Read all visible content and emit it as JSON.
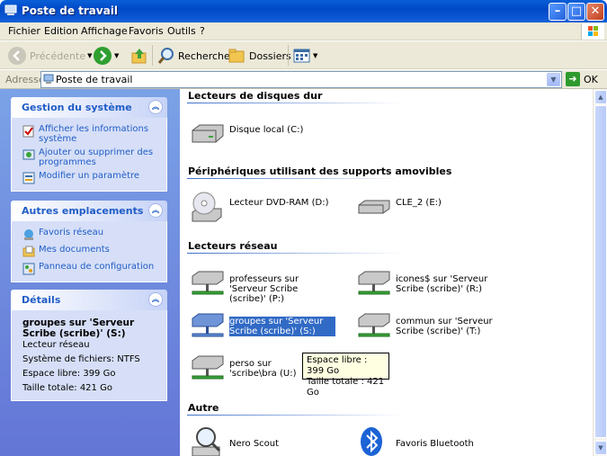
{
  "window": {
    "title": "Poste de travail"
  },
  "menu": [
    "Fichier",
    "Edition",
    "Affichage",
    "Favoris",
    "Outils",
    "?"
  ],
  "toolbar": {
    "back": "Précédente",
    "search": "Rechercher",
    "folders": "Dossiers"
  },
  "address": {
    "label": "Adresse",
    "value": "Poste de travail",
    "go": "OK"
  },
  "sidebar": {
    "system": {
      "title": "Gestion du système",
      "items": [
        {
          "label": "Afficher les informations système",
          "icon": "system-info-icon"
        },
        {
          "label": "Ajouter ou supprimer des programmes",
          "icon": "add-remove-icon"
        },
        {
          "label": "Modifier un paramètre",
          "icon": "settings-icon"
        }
      ]
    },
    "places": {
      "title": "Autres emplacements",
      "items": [
        {
          "label": "Favoris réseau",
          "icon": "network-icon"
        },
        {
          "label": "Mes documents",
          "icon": "folder-icon"
        },
        {
          "label": "Panneau de configuration",
          "icon": "control-panel-icon"
        }
      ]
    },
    "details": {
      "title": "Détails",
      "name": "groupes sur 'Serveur Scribe (scribe)' (S:)",
      "type": "Lecteur réseau",
      "fs": "Système de fichiers: NTFS",
      "free": "Espace libre: 399 Go",
      "total": "Taille totale: 421 Go"
    }
  },
  "groups": {
    "hdd": {
      "title": "Lecteurs de disques dur",
      "items": [
        "Disque local (C:)"
      ]
    },
    "removable": {
      "title": "Périphériques utilisant des supports amovibles",
      "items": [
        "Lecteur DVD-RAM (D:)",
        "CLE_2 (E:)"
      ]
    },
    "network": {
      "title": "Lecteurs réseau",
      "items": [
        "professeurs sur 'Serveur Scribe (scribe)' (P:)",
        "icones$ sur 'Serveur Scribe (scribe)' (R:)",
        "groupes sur 'Serveur Scribe (scribe)' (S:)",
        "commun sur 'Serveur Scribe (scribe)' (T:)",
        "perso sur 'scribe\\bra (U:)"
      ]
    },
    "other": {
      "title": "Autre",
      "items": [
        "Nero Scout",
        "Favoris Bluetooth"
      ]
    }
  },
  "tooltip": {
    "line1": "Espace libre : 399 Go",
    "line2": "Taille totale : 421 Go"
  },
  "colors": {
    "titlebar": "#0a5fd8",
    "sidebar_link": "#215dc6",
    "selection": "#316ac5"
  }
}
